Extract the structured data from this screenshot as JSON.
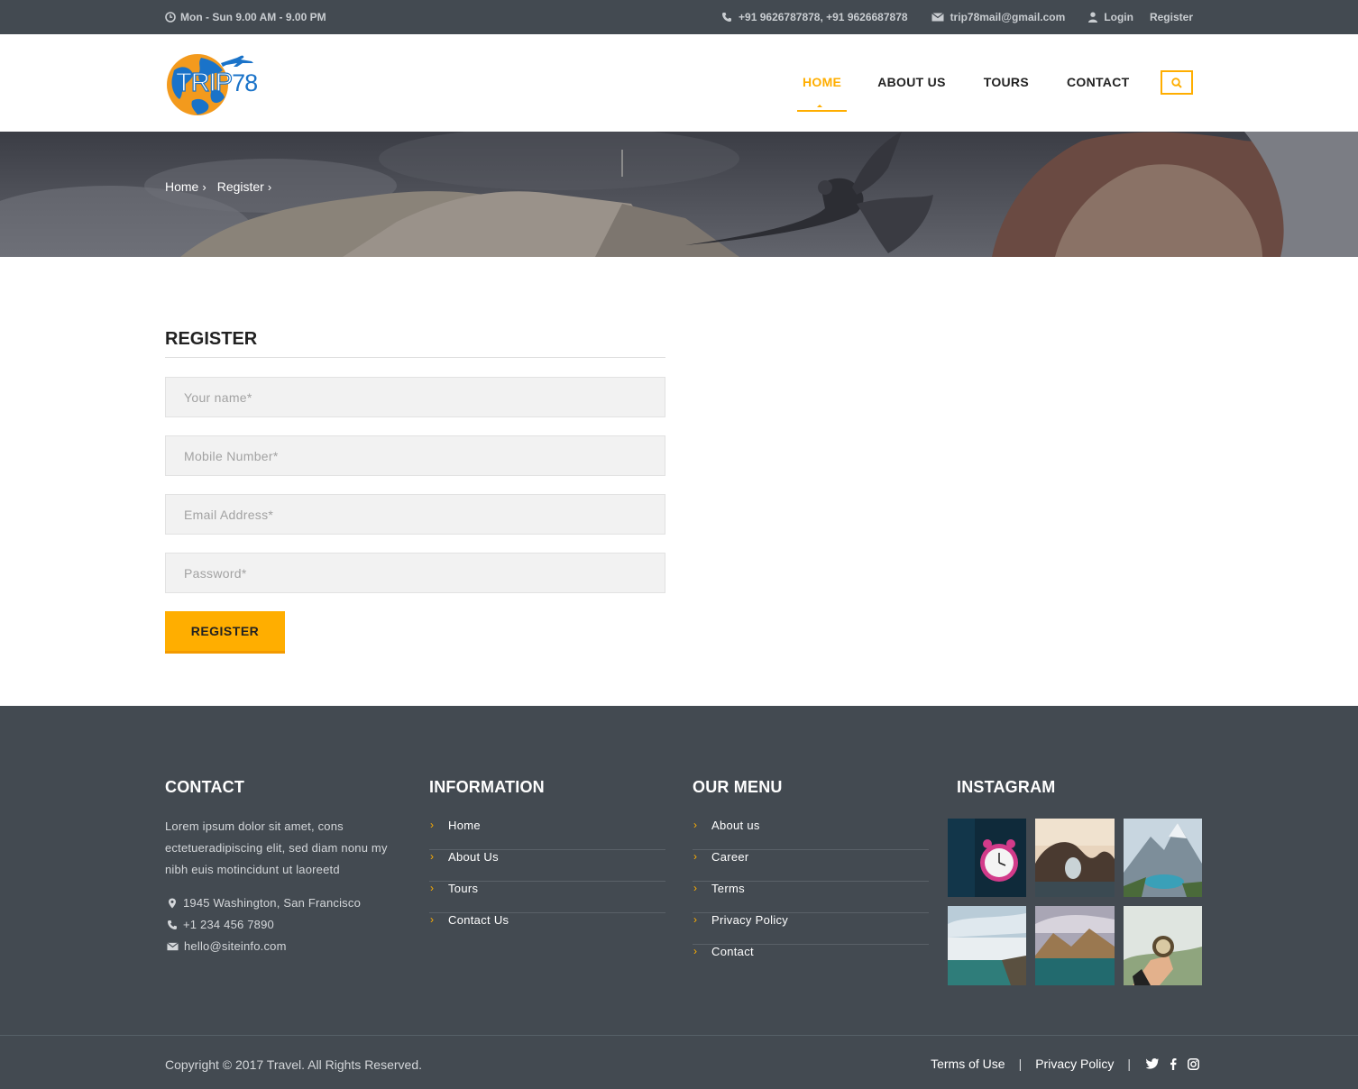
{
  "topbar": {
    "hours": "Mon - Sun 9.00 AM - 9.00 PM",
    "phones": "+91 9626787878, +91 9626687878",
    "email": "trip78mail@gmail.com",
    "login": "Login",
    "register": "Register"
  },
  "logo": {
    "text_main": "TRIP",
    "text_num": "78"
  },
  "nav": {
    "home": "HOME",
    "about": "ABOUT US",
    "tours": "TOURS",
    "contact": "CONTACT"
  },
  "breadcrumb": {
    "home": "Home",
    "current": "Register"
  },
  "form": {
    "title": "REGISTER",
    "name_placeholder": "Your name*",
    "mobile_placeholder": "Mobile Number*",
    "email_placeholder": "Email Address*",
    "password_placeholder": "Password*",
    "submit": "REGISTER"
  },
  "footer": {
    "contact": {
      "title": "CONTACT",
      "text": "Lorem ipsum dolor sit amet, cons ectetueradipiscing elit, sed diam nonu my nibh euis motincidunt ut laoreetd",
      "address": "1945 Washington, San Francisco",
      "phone": "+1 234 456 7890",
      "email": "hello@siteinfo.com"
    },
    "information": {
      "title": "INFORMATION",
      "items": [
        "Home",
        "About Us",
        "Tours",
        "Contact Us"
      ]
    },
    "menu": {
      "title": "OUR MENU",
      "items": [
        "About us",
        "Career",
        "Terms",
        "Privacy Policy",
        "Contact"
      ]
    },
    "instagram": {
      "title": "INSTAGRAM"
    },
    "copyright": "Copyright © 2017 Travel. All Rights Reserved.",
    "terms": "Terms of Use",
    "privacy": "Privacy Policy",
    "separator": "|"
  },
  "colors": {
    "accent": "#ffae00",
    "dark": "#434a51"
  }
}
